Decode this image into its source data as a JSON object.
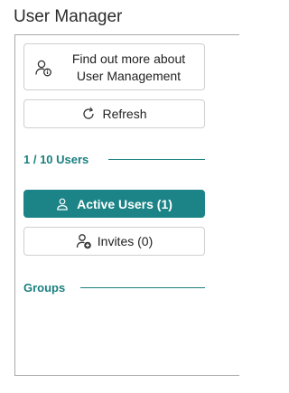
{
  "header": {
    "title": "User Manager"
  },
  "panel": {
    "learn_more_button": {
      "label": "Find out more about User Management",
      "icon": "user-info-icon"
    },
    "refresh_button": {
      "label": "Refresh",
      "icon": "refresh-icon"
    },
    "user_count": {
      "label": "1 / 10 Users"
    },
    "active_users_button": {
      "label": "Active Users (1)",
      "icon": "person-icon"
    },
    "invites_button": {
      "label": "Invites (0)",
      "icon": "person-add-icon"
    },
    "groups_section": {
      "label": "Groups"
    }
  },
  "colors": {
    "accent": "#1c8486",
    "section_text": "#1a7f7f",
    "border": "#cfcfcf"
  }
}
